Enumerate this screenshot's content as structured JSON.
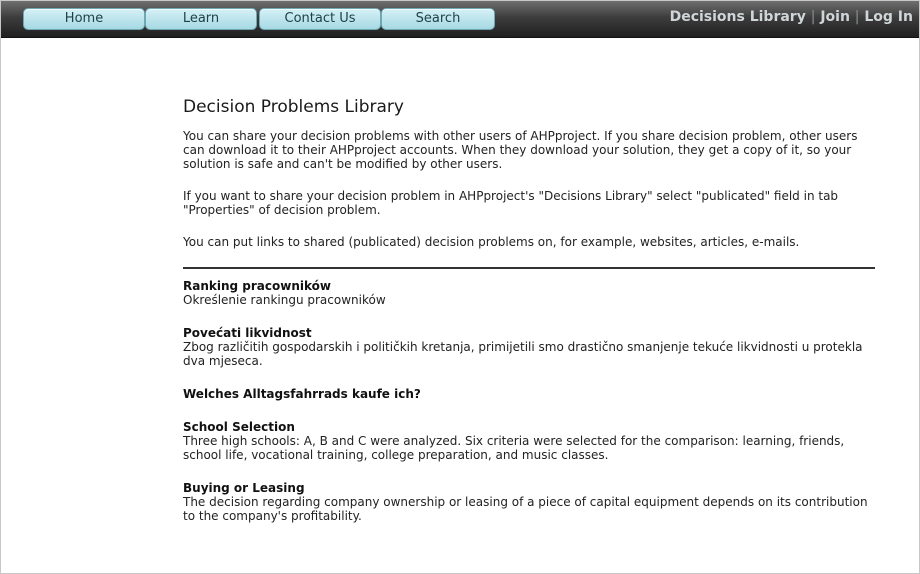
{
  "nav": {
    "buttons": [
      {
        "label": "Home"
      },
      {
        "label": "Learn"
      },
      {
        "label": "Contact Us"
      },
      {
        "label": "Search"
      }
    ],
    "right_links": {
      "library": "Decisions Library",
      "separator": "|",
      "join": "Join",
      "login": "Log In"
    }
  },
  "main": {
    "title": "Decision Problems Library",
    "intro": [
      "You can share your decision problems with other users of AHPproject. If you share decision problem, other users can download it to their AHPproject accounts. When they download your solution, they get a copy of it, so your solution is safe and can't be modified by other users.",
      "If you want to share your decision problem in AHPproject's \"Decisions Library\" select \"publicated\" field in tab \"Properties\" of decision problem.",
      "You can put links to shared (publicated) decision problems on, for example, websites, articles, e-mails."
    ],
    "items": [
      {
        "title": "Ranking pracowników",
        "desc": "Określenie rankingu pracowników"
      },
      {
        "title": "Povećati likvidnost",
        "desc": "Zbog različitih gospodarskih i političkih kretanja, primijetili smo drastično smanjenje tekuće likvidnosti u protekla dva mjeseca."
      },
      {
        "title": "Welches Alltagsfahrrads kaufe ich?",
        "desc": ""
      },
      {
        "title": "School Selection",
        "desc": "Three high schools: A, B and C were analyzed. Six criteria were selected for the comparison: learning, friends, school life, vocational training, college preparation, and music classes."
      },
      {
        "title": "Buying or Leasing",
        "desc": "The decision regarding company ownership or leasing of a piece of capital equipment depends on its contribution to the company's profitability."
      }
    ]
  },
  "colors": {
    "nav_button_bg": "#a6d9e4",
    "nav_bar_bg": "#3d3d3d",
    "nav_link_text": "#d0d6d8"
  }
}
